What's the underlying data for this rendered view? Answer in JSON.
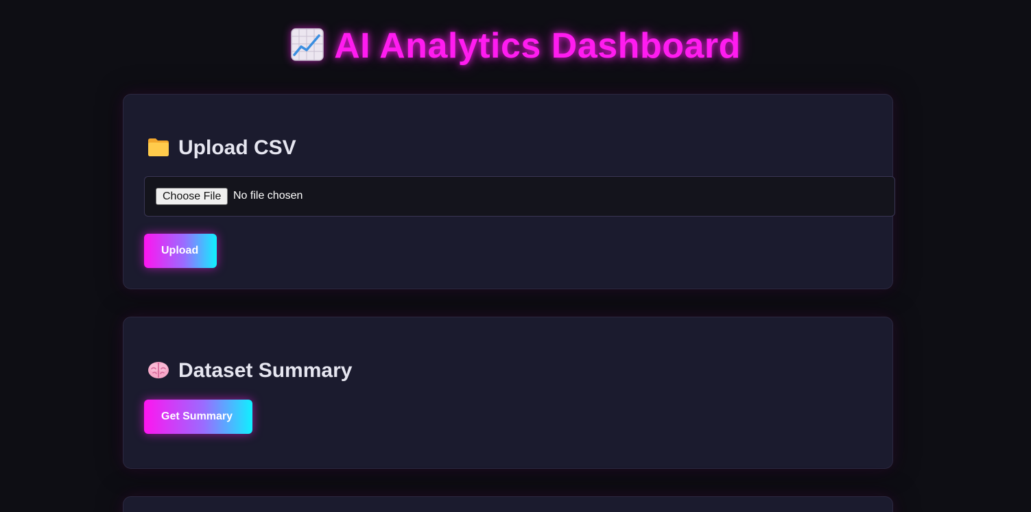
{
  "header": {
    "title": "AI Analytics Dashboard",
    "title_icon": "chart-increasing-icon",
    "title_color": "#ff1cf0"
  },
  "upload": {
    "heading": "Upload CSV",
    "heading_icon": "folder-icon",
    "choose_file_label": "Choose File",
    "file_status": "No file chosen",
    "upload_button": "Upload"
  },
  "summary": {
    "heading": "Dataset Summary",
    "heading_icon": "brain-icon",
    "button": "Get Summary"
  },
  "colors": {
    "background": "#0e0e14",
    "card": "#1b1b2e",
    "accent_pink": "#ff14f0",
    "accent_cyan": "#10f0ff"
  }
}
